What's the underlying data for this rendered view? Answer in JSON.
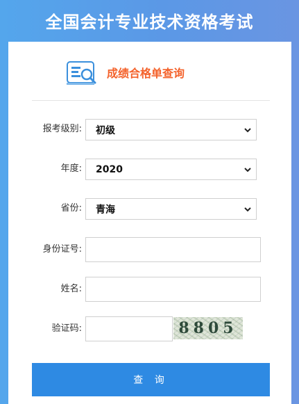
{
  "header": {
    "title": "全国会计专业技术资格考试"
  },
  "card": {
    "title": "成绩合格单查询",
    "icon": "document-search-icon"
  },
  "form": {
    "level": {
      "label": "报考级别:",
      "value": "初级"
    },
    "year": {
      "label": "年度:",
      "value": "2020"
    },
    "province": {
      "label": "省份:",
      "value": "青海"
    },
    "id_number": {
      "label": "身份证号:",
      "value": ""
    },
    "name": {
      "label": "姓名:",
      "value": ""
    },
    "captcha": {
      "label": "验证码:",
      "value": "",
      "image_text": "8805"
    }
  },
  "submit": {
    "label": "查 询"
  },
  "colors": {
    "header_bg": "#5a9fe8",
    "title_accent": "#f4622b",
    "button_bg": "#2e8ae3",
    "icon_blue": "#3a8fdc"
  }
}
